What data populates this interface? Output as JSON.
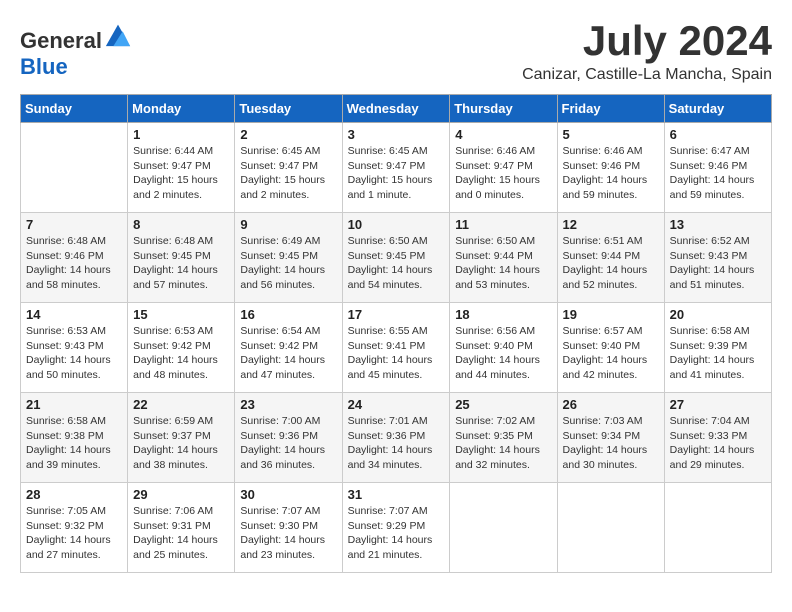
{
  "header": {
    "logo_general": "General",
    "logo_blue": "Blue",
    "month_title": "July 2024",
    "location": "Canizar, Castille-La Mancha, Spain"
  },
  "weekdays": [
    "Sunday",
    "Monday",
    "Tuesday",
    "Wednesday",
    "Thursday",
    "Friday",
    "Saturday"
  ],
  "weeks": [
    [
      {
        "day": "",
        "sunrise": "",
        "sunset": "",
        "daylight": ""
      },
      {
        "day": "1",
        "sunrise": "Sunrise: 6:44 AM",
        "sunset": "Sunset: 9:47 PM",
        "daylight": "Daylight: 15 hours and 2 minutes."
      },
      {
        "day": "2",
        "sunrise": "Sunrise: 6:45 AM",
        "sunset": "Sunset: 9:47 PM",
        "daylight": "Daylight: 15 hours and 2 minutes."
      },
      {
        "day": "3",
        "sunrise": "Sunrise: 6:45 AM",
        "sunset": "Sunset: 9:47 PM",
        "daylight": "Daylight: 15 hours and 1 minute."
      },
      {
        "day": "4",
        "sunrise": "Sunrise: 6:46 AM",
        "sunset": "Sunset: 9:47 PM",
        "daylight": "Daylight: 15 hours and 0 minutes."
      },
      {
        "day": "5",
        "sunrise": "Sunrise: 6:46 AM",
        "sunset": "Sunset: 9:46 PM",
        "daylight": "Daylight: 14 hours and 59 minutes."
      },
      {
        "day": "6",
        "sunrise": "Sunrise: 6:47 AM",
        "sunset": "Sunset: 9:46 PM",
        "daylight": "Daylight: 14 hours and 59 minutes."
      }
    ],
    [
      {
        "day": "7",
        "sunrise": "Sunrise: 6:48 AM",
        "sunset": "Sunset: 9:46 PM",
        "daylight": "Daylight: 14 hours and 58 minutes."
      },
      {
        "day": "8",
        "sunrise": "Sunrise: 6:48 AM",
        "sunset": "Sunset: 9:45 PM",
        "daylight": "Daylight: 14 hours and 57 minutes."
      },
      {
        "day": "9",
        "sunrise": "Sunrise: 6:49 AM",
        "sunset": "Sunset: 9:45 PM",
        "daylight": "Daylight: 14 hours and 56 minutes."
      },
      {
        "day": "10",
        "sunrise": "Sunrise: 6:50 AM",
        "sunset": "Sunset: 9:45 PM",
        "daylight": "Daylight: 14 hours and 54 minutes."
      },
      {
        "day": "11",
        "sunrise": "Sunrise: 6:50 AM",
        "sunset": "Sunset: 9:44 PM",
        "daylight": "Daylight: 14 hours and 53 minutes."
      },
      {
        "day": "12",
        "sunrise": "Sunrise: 6:51 AM",
        "sunset": "Sunset: 9:44 PM",
        "daylight": "Daylight: 14 hours and 52 minutes."
      },
      {
        "day": "13",
        "sunrise": "Sunrise: 6:52 AM",
        "sunset": "Sunset: 9:43 PM",
        "daylight": "Daylight: 14 hours and 51 minutes."
      }
    ],
    [
      {
        "day": "14",
        "sunrise": "Sunrise: 6:53 AM",
        "sunset": "Sunset: 9:43 PM",
        "daylight": "Daylight: 14 hours and 50 minutes."
      },
      {
        "day": "15",
        "sunrise": "Sunrise: 6:53 AM",
        "sunset": "Sunset: 9:42 PM",
        "daylight": "Daylight: 14 hours and 48 minutes."
      },
      {
        "day": "16",
        "sunrise": "Sunrise: 6:54 AM",
        "sunset": "Sunset: 9:42 PM",
        "daylight": "Daylight: 14 hours and 47 minutes."
      },
      {
        "day": "17",
        "sunrise": "Sunrise: 6:55 AM",
        "sunset": "Sunset: 9:41 PM",
        "daylight": "Daylight: 14 hours and 45 minutes."
      },
      {
        "day": "18",
        "sunrise": "Sunrise: 6:56 AM",
        "sunset": "Sunset: 9:40 PM",
        "daylight": "Daylight: 14 hours and 44 minutes."
      },
      {
        "day": "19",
        "sunrise": "Sunrise: 6:57 AM",
        "sunset": "Sunset: 9:40 PM",
        "daylight": "Daylight: 14 hours and 42 minutes."
      },
      {
        "day": "20",
        "sunrise": "Sunrise: 6:58 AM",
        "sunset": "Sunset: 9:39 PM",
        "daylight": "Daylight: 14 hours and 41 minutes."
      }
    ],
    [
      {
        "day": "21",
        "sunrise": "Sunrise: 6:58 AM",
        "sunset": "Sunset: 9:38 PM",
        "daylight": "Daylight: 14 hours and 39 minutes."
      },
      {
        "day": "22",
        "sunrise": "Sunrise: 6:59 AM",
        "sunset": "Sunset: 9:37 PM",
        "daylight": "Daylight: 14 hours and 38 minutes."
      },
      {
        "day": "23",
        "sunrise": "Sunrise: 7:00 AM",
        "sunset": "Sunset: 9:36 PM",
        "daylight": "Daylight: 14 hours and 36 minutes."
      },
      {
        "day": "24",
        "sunrise": "Sunrise: 7:01 AM",
        "sunset": "Sunset: 9:36 PM",
        "daylight": "Daylight: 14 hours and 34 minutes."
      },
      {
        "day": "25",
        "sunrise": "Sunrise: 7:02 AM",
        "sunset": "Sunset: 9:35 PM",
        "daylight": "Daylight: 14 hours and 32 minutes."
      },
      {
        "day": "26",
        "sunrise": "Sunrise: 7:03 AM",
        "sunset": "Sunset: 9:34 PM",
        "daylight": "Daylight: 14 hours and 30 minutes."
      },
      {
        "day": "27",
        "sunrise": "Sunrise: 7:04 AM",
        "sunset": "Sunset: 9:33 PM",
        "daylight": "Daylight: 14 hours and 29 minutes."
      }
    ],
    [
      {
        "day": "28",
        "sunrise": "Sunrise: 7:05 AM",
        "sunset": "Sunset: 9:32 PM",
        "daylight": "Daylight: 14 hours and 27 minutes."
      },
      {
        "day": "29",
        "sunrise": "Sunrise: 7:06 AM",
        "sunset": "Sunset: 9:31 PM",
        "daylight": "Daylight: 14 hours and 25 minutes."
      },
      {
        "day": "30",
        "sunrise": "Sunrise: 7:07 AM",
        "sunset": "Sunset: 9:30 PM",
        "daylight": "Daylight: 14 hours and 23 minutes."
      },
      {
        "day": "31",
        "sunrise": "Sunrise: 7:07 AM",
        "sunset": "Sunset: 9:29 PM",
        "daylight": "Daylight: 14 hours and 21 minutes."
      },
      {
        "day": "",
        "sunrise": "",
        "sunset": "",
        "daylight": ""
      },
      {
        "day": "",
        "sunrise": "",
        "sunset": "",
        "daylight": ""
      },
      {
        "day": "",
        "sunrise": "",
        "sunset": "",
        "daylight": ""
      }
    ]
  ]
}
